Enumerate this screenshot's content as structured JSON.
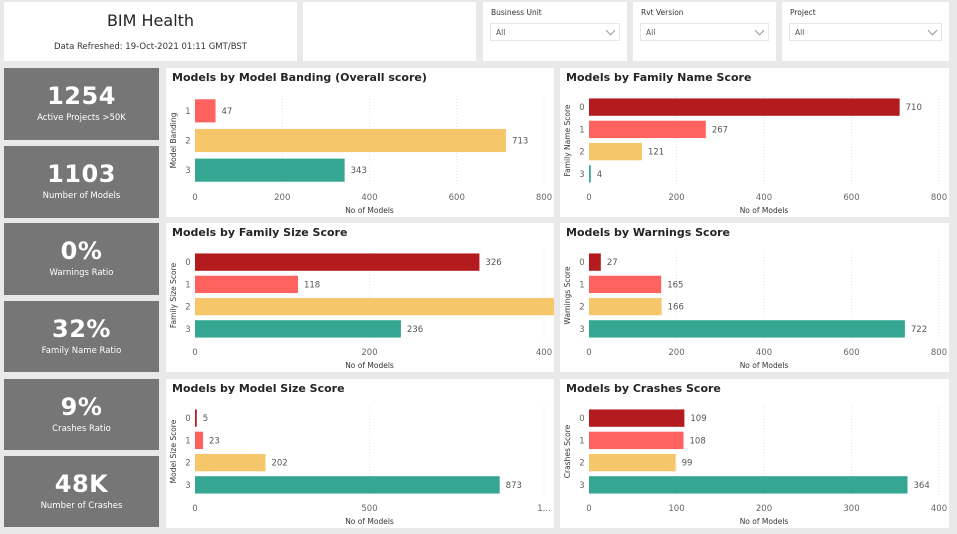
{
  "header": {
    "title": "BIM Health",
    "refreshed": "Data Refreshed: 19-Oct-2021 01:11 GMT/BST"
  },
  "slicers": [
    {
      "label": "Business Unit",
      "value": "All"
    },
    {
      "label": "Rvt Version",
      "value": "All"
    },
    {
      "label": "Project",
      "value": "All"
    }
  ],
  "kpis": [
    {
      "value": "1254",
      "label": "Active Projects >50K"
    },
    {
      "value": "1103",
      "label": "Number of Models"
    },
    {
      "value": "0%",
      "label": "Warnings Ratio"
    },
    {
      "value": "32%",
      "label": "Family Name Ratio"
    },
    {
      "value": "9%",
      "label": "Crashes Ratio"
    },
    {
      "value": "48K",
      "label": "Number of Crashes"
    }
  ],
  "colors": {
    "score0": "#b41b1e",
    "score1": "#fd625e",
    "score2": "#f5c76a",
    "score3": "#34a691",
    "kpi_bg": "#767676"
  },
  "chart_data": [
    {
      "type": "bar",
      "orientation": "horizontal",
      "title": "Models by Model Banding (Overall score)",
      "ylabel": "Model Banding",
      "xlabel": "No of Models",
      "categories": [
        "1",
        "2",
        "3"
      ],
      "values": [
        47,
        713,
        343
      ],
      "color_keys": [
        "score1",
        "score2",
        "score3"
      ],
      "xlim": [
        0,
        800
      ],
      "xticks": [
        "0",
        "200",
        "400",
        "600",
        "800"
      ]
    },
    {
      "type": "bar",
      "orientation": "horizontal",
      "title": "Models by Family Name Score",
      "ylabel": "Family Name Score",
      "xlabel": "No of Models",
      "categories": [
        "0",
        "1",
        "2",
        "3"
      ],
      "values": [
        710,
        267,
        121,
        4
      ],
      "color_keys": [
        "score0",
        "score1",
        "score2",
        "score3"
      ],
      "xlim": [
        0,
        800
      ],
      "xticks": [
        "0",
        "200",
        "400",
        "600",
        "800"
      ]
    },
    {
      "type": "bar",
      "orientation": "horizontal",
      "title": "Models by Family Size Score",
      "ylabel": "Family Size Score",
      "xlabel": "No of Models",
      "categories": [
        "0",
        "1",
        "2",
        "3"
      ],
      "values": [
        326,
        118,
        423,
        236
      ],
      "color_keys": [
        "score0",
        "score1",
        "score2",
        "score3"
      ],
      "xlim": [
        0,
        400
      ],
      "xticks": [
        "0",
        "200",
        "400"
      ]
    },
    {
      "type": "bar",
      "orientation": "horizontal",
      "title": "Models by Warnings Score",
      "ylabel": "Warnings Score",
      "xlabel": "No of Models",
      "categories": [
        "0",
        "1",
        "2",
        "3"
      ],
      "values": [
        27,
        165,
        166,
        722
      ],
      "color_keys": [
        "score0",
        "score1",
        "score2",
        "score3"
      ],
      "xlim": [
        0,
        800
      ],
      "xticks": [
        "0",
        "200",
        "400",
        "600",
        "800"
      ]
    },
    {
      "type": "bar",
      "orientation": "horizontal",
      "title": "Models by Model Size Score",
      "ylabel": "Model Size Score",
      "xlabel": "No of Models",
      "categories": [
        "0",
        "1",
        "2",
        "3"
      ],
      "values": [
        5,
        23,
        202,
        873
      ],
      "color_keys": [
        "score0",
        "score1",
        "score2",
        "score3"
      ],
      "xlim": [
        0,
        1000
      ],
      "xticks": [
        "0",
        "500",
        "1..."
      ]
    },
    {
      "type": "bar",
      "orientation": "horizontal",
      "title": "Models by Crashes Score",
      "ylabel": "Crashes Score",
      "xlabel": "No of Models",
      "categories": [
        "0",
        "1",
        "2",
        "3"
      ],
      "values": [
        109,
        108,
        99,
        364
      ],
      "color_keys": [
        "score0",
        "score1",
        "score2",
        "score3"
      ],
      "xlim": [
        0,
        400
      ],
      "xticks": [
        "0",
        "100",
        "200",
        "300",
        "400"
      ]
    }
  ]
}
